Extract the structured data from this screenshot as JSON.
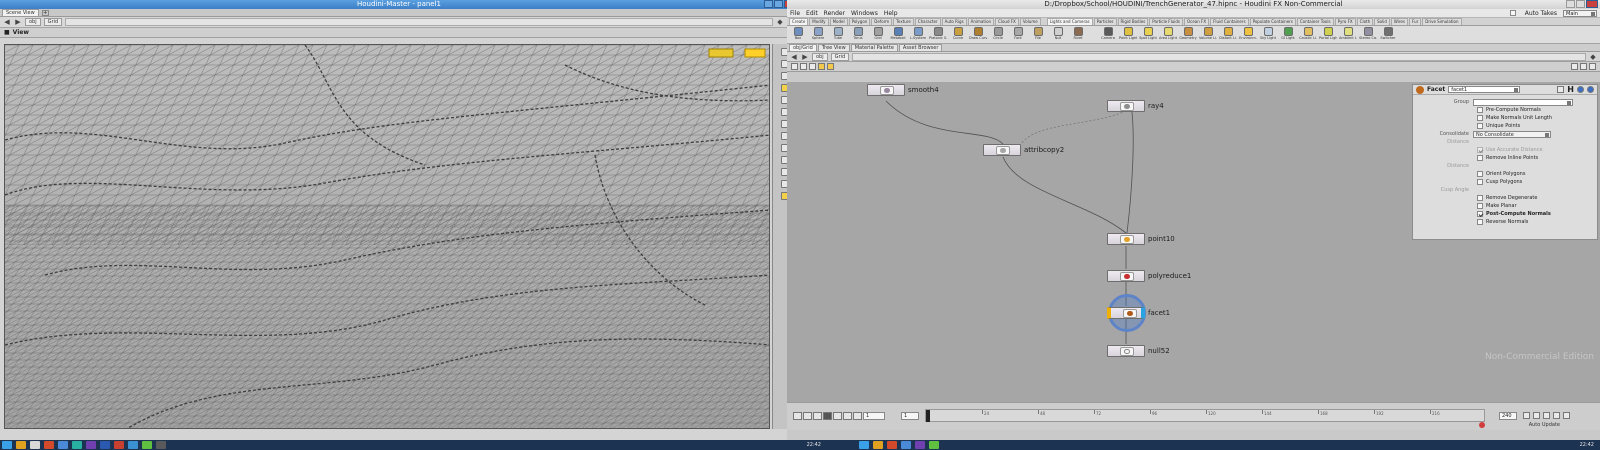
{
  "left_window": {
    "title": "Houdini-Master - panel1",
    "tab_label": "Scene View",
    "path_obj": "obj",
    "path_node": "Grid",
    "view_label": "View"
  },
  "right_window": {
    "title": "D:/Dropbox/School/HOUDINI/TrenchGenerator_47.hipnc - Houdini FX Non-Commercial",
    "menus": [
      "File",
      "Edit",
      "Render",
      "Windows",
      "Help"
    ],
    "auto_takes_label": "Auto Takes",
    "main_label": "Main",
    "shelf_tabs_left": [
      "Create",
      "Modify",
      "Model",
      "Polygon",
      "Deform",
      "Texture",
      "Character",
      "Auto Rigs",
      "Animation",
      "Cloud FX",
      "Volume"
    ],
    "shelf_tabs_right": [
      "Lights and Cameras",
      "Particles",
      "Rigid Bodies",
      "Particle Fluids",
      "Ocean FX",
      "Fluid Containers",
      "Populate Containers",
      "Container Tools",
      "Pyro FX",
      "Cloth",
      "Solid",
      "Wires",
      "Fur",
      "Drive Simulation"
    ],
    "shelf_tools_left": [
      "Box",
      "Sphere",
      "Tube",
      "Torus",
      "Grid",
      "Metaball",
      "L-System",
      "Platonic S.",
      "Curve",
      "Draw Curve",
      "Circle",
      "Font",
      "File",
      "Null",
      "Rivet"
    ],
    "shelf_tools_right": [
      "Camera",
      "Point Light",
      "Spot Light",
      "Area Light",
      "Geometry",
      "Volume Li.",
      "Distant Li.",
      "Environm.",
      "Sky Light",
      "GI Light",
      "Caustic Li.",
      "Portal Light",
      "Ambient L.",
      "Stereo Ca.",
      "Switcher"
    ],
    "pane_tabs": [
      "obj/Grid",
      "Tree View",
      "Material Palette",
      "Asset Browser"
    ],
    "net_path_obj": "obj",
    "net_path_node": "Grid",
    "watermark": "Non-Commercial Edition"
  },
  "network": {
    "nodes": [
      {
        "label": "smooth4"
      },
      {
        "label": "ray4"
      },
      {
        "label": "attribcopy2"
      },
      {
        "label": "point10"
      },
      {
        "label": "polyreduce1"
      },
      {
        "label": "facet1"
      },
      {
        "label": "null52"
      }
    ]
  },
  "params": {
    "node_type": "Facet",
    "node_name": "facet1",
    "group_label": "Group",
    "consolidate_label": "Consolidate",
    "consolidate_value": "No Consolidate",
    "distance_label": "Distance",
    "distance2_label": "Distance",
    "cusp_label": "Cusp Angle",
    "checks": {
      "pre_compute_normals": "Pre-Compute Normals",
      "make_normals_unit": "Make Normals Unit Length",
      "unique_points": "Unique Points",
      "use_accurate_distance": "Use Accurate Distance",
      "remove_inline_points": "Remove Inline Points",
      "orient_polygons": "Orient Polygons",
      "cusp_polygons": "Cusp Polygons",
      "remove_degenerate": "Remove Degenerate",
      "make_planar": "Make Planar",
      "post_compute_normals": "Post-Compute Normals",
      "reverse_normals": "Reverse Normals"
    }
  },
  "timeline": {
    "start_frame": "1",
    "current_frame": "1",
    "end_frame": "240",
    "ticks": [
      "24",
      "48",
      "72",
      "96",
      "120",
      "144",
      "168",
      "192",
      "216"
    ],
    "auto_update": "Auto Update"
  },
  "taskbar": {
    "clock_left": "22:42",
    "clock_right": "22:42"
  },
  "colors": {
    "accent_selection": "#5d83c8",
    "display_flag": "#2aa4e0",
    "render_flag": "#f0b000"
  }
}
